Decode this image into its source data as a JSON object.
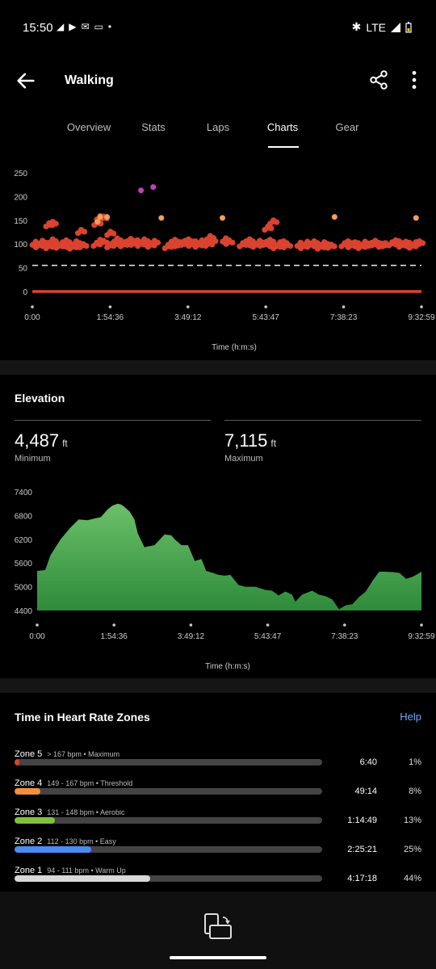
{
  "status_bar": {
    "time": "15:50",
    "network": "LTE",
    "icons": [
      "telegram-icon",
      "youtube-icon",
      "outlook-icon",
      "screen-icon",
      "dot-icon"
    ]
  },
  "header": {
    "title": "Walking"
  },
  "tabs": [
    {
      "label": "Overview",
      "active": false
    },
    {
      "label": "Stats",
      "active": false
    },
    {
      "label": "Laps",
      "active": false
    },
    {
      "label": "Charts",
      "active": true
    },
    {
      "label": "Gear",
      "active": false
    }
  ],
  "hr_chart": {
    "y_ticks": [
      "250",
      "200",
      "150",
      "100",
      "50",
      "0"
    ],
    "x_ticks": [
      "0:00",
      "1:54:36",
      "3:49:12",
      "5:43:47",
      "7:38:23",
      "9:32:59"
    ],
    "x_label": "Time (h:m:s)",
    "colors": {
      "main": "#d9432f",
      "high": "#f0a05a",
      "max": "#c23fc0",
      "baseline": "#d9432f"
    }
  },
  "chart_data": [
    {
      "type": "scatter",
      "title": "",
      "xlabel": "Time (h:m:s)",
      "ylabel": "",
      "xlim": [
        "0:00",
        "9:32:59"
      ],
      "ylim": [
        0,
        250
      ],
      "reference_line": 55,
      "series": [
        {
          "name": "",
          "points": [
            [
              "0:05",
              103
            ],
            [
              "0:10",
              98
            ],
            [
              "0:15",
              105
            ],
            [
              "0:20",
              101
            ],
            [
              "0:25",
              96
            ],
            [
              "0:30",
              108
            ],
            [
              "0:35",
              100
            ],
            [
              "0:40",
              97
            ],
            [
              "0:45",
              102
            ],
            [
              "0:50",
              106
            ],
            [
              "0:55",
              99
            ],
            [
              "1:00",
              95
            ],
            [
              "1:05",
              104
            ],
            [
              "1:10",
              100
            ],
            [
              "1:15",
              98
            ],
            [
              "1:35",
              101
            ],
            [
              "1:40",
              107
            ],
            [
              "1:45",
              105
            ],
            [
              "1:55",
              98
            ],
            [
              "2:00",
              102
            ],
            [
              "2:05",
              110
            ],
            [
              "2:10",
              106
            ],
            [
              "2:15",
              100
            ],
            [
              "2:20",
              104
            ],
            [
              "2:25",
              109
            ],
            [
              "2:30",
              103
            ],
            [
              "2:35",
              106
            ],
            [
              "2:40",
              101
            ],
            [
              "2:45",
              108
            ],
            [
              "2:50",
              104
            ],
            [
              "2:55",
              99
            ],
            [
              "3:00",
              105
            ],
            [
              "3:20",
              96
            ],
            [
              "3:25",
              103
            ],
            [
              "3:30",
              107
            ],
            [
              "3:35",
              100
            ],
            [
              "3:40",
              102
            ],
            [
              "3:45",
              105
            ],
            [
              "3:50",
              108
            ],
            [
              "3:55",
              101
            ],
            [
              "4:00",
              104
            ],
            [
              "4:05",
              99
            ],
            [
              "4:10",
              106
            ],
            [
              "4:15",
              103
            ],
            [
              "4:20",
              101
            ],
            [
              "4:45",
              110
            ],
            [
              "4:50",
              105
            ],
            [
              "5:10",
              100
            ],
            [
              "5:15",
              104
            ],
            [
              "5:20",
              108
            ],
            [
              "5:25",
              102
            ],
            [
              "5:30",
              99
            ],
            [
              "5:35",
              105
            ],
            [
              "5:40",
              101
            ],
            [
              "5:45",
              103
            ],
            [
              "5:50",
              107
            ],
            [
              "5:55",
              100
            ],
            [
              "6:00",
              96
            ],
            [
              "6:05",
              102
            ],
            [
              "6:10",
              104
            ],
            [
              "6:15",
              98
            ],
            [
              "6:35",
              101
            ],
            [
              "6:40",
              96
            ],
            [
              "6:45",
              103
            ],
            [
              "6:50",
              99
            ],
            [
              "6:55",
              104
            ],
            [
              "7:00",
              100
            ],
            [
              "7:05",
              95
            ],
            [
              "7:10",
              102
            ],
            [
              "7:15",
              98
            ],
            [
              "7:20",
              97
            ],
            [
              "7:40",
              100
            ],
            [
              "7:45",
              104
            ],
            [
              "7:50",
              98
            ],
            [
              "7:55",
              102
            ],
            [
              "8:00",
              100
            ],
            [
              "8:05",
              96
            ],
            [
              "8:10",
              103
            ],
            [
              "8:15",
              99
            ],
            [
              "8:20",
              101
            ],
            [
              "8:25",
              105
            ],
            [
              "8:35",
              99
            ],
            [
              "8:40",
              100
            ],
            [
              "8:50",
              102
            ],
            [
              "8:55",
              106
            ],
            [
              "9:00",
              104
            ],
            [
              "9:05",
              99
            ],
            [
              "9:10",
              103
            ],
            [
              "9:15",
              101
            ],
            [
              "9:20",
              97
            ],
            [
              "9:25",
              102
            ],
            [
              "9:30",
              104
            ],
            [
              "0:30",
              145
            ],
            [
              "0:25",
              142
            ],
            [
              "1:12",
              128
            ],
            [
              "1:36",
              145
            ],
            [
              "1:40",
              157
            ],
            [
              "1:45",
              156
            ],
            [
              "1:55",
              124
            ],
            [
              "4:25",
              108
            ],
            [
              "4:22",
              115
            ],
            [
              "5:55",
              148
            ],
            [
              "5:47",
              135
            ]
          ]
        },
        {
          "name": "",
          "points": [
            [
              "1:40",
              157
            ],
            [
              "1:50",
              157
            ],
            [
              "3:10",
              155
            ],
            [
              "4:40",
              155
            ],
            [
              "7:25",
              157
            ],
            [
              "9:25",
              155
            ],
            [
              "1:36",
              147
            ]
          ]
        },
        {
          "name": "",
          "points": [
            [
              "2:40",
              213
            ],
            [
              "2:58",
              220
            ]
          ]
        },
        {
          "name": "",
          "points": [
            [
              "0:00",
              0
            ],
            [
              "9:32:59",
              0
            ]
          ]
        }
      ]
    },
    {
      "type": "area",
      "title": "Elevation",
      "xlabel": "Time (h:m:s)",
      "ylabel": "",
      "xlim": [
        "0:00",
        "9:32:59"
      ],
      "ylim": [
        4400,
        7400
      ],
      "color": "#4caf50",
      "x_minutes": [
        0,
        12,
        20,
        35,
        50,
        62,
        75,
        85,
        95,
        105,
        112,
        120,
        125,
        130,
        138,
        145,
        150,
        160,
        175,
        190,
        200,
        205,
        215,
        225,
        235,
        245,
        252,
        262,
        270,
        280,
        288,
        300,
        310,
        325,
        340,
        350,
        360,
        370,
        380,
        385,
        395,
        410,
        420,
        430,
        440,
        450,
        460,
        470,
        480,
        490,
        500,
        510,
        520,
        530,
        540,
        550,
        560,
        570,
        573
      ],
      "values": [
        5400,
        5420,
        5800,
        6200,
        6500,
        6700,
        6680,
        6720,
        6760,
        6950,
        7050,
        7100,
        7080,
        7020,
        6900,
        6700,
        6350,
        6000,
        6050,
        6320,
        6300,
        6200,
        6050,
        6050,
        5650,
        5700,
        5400,
        5350,
        5300,
        5280,
        5300,
        5050,
        5000,
        5000,
        4920,
        4900,
        4780,
        4880,
        4800,
        4620,
        4800,
        4900,
        4800,
        4760,
        4680,
        4430,
        4530,
        4560,
        4740,
        4880,
        5150,
        5380,
        5380,
        5370,
        5350,
        5200,
        5250,
        5350,
        5380
      ]
    }
  ],
  "elevation": {
    "title": "Elevation",
    "min_value": "4,487",
    "min_unit": "ft",
    "min_label": "Minimum",
    "max_value": "7,115",
    "max_unit": "ft",
    "max_label": "Maximum",
    "y_ticks": [
      "7400",
      "6800",
      "6200",
      "5600",
      "5000",
      "4400"
    ],
    "x_ticks": [
      "0:00",
      "1:54:36",
      "3:49:12",
      "5:43:47",
      "7:38:23",
      "9:32:59"
    ],
    "x_label": "Time (h:m:s)"
  },
  "zones": {
    "title": "Time in Heart Rate Zones",
    "help": "Help",
    "items": [
      {
        "name": "Zone 5",
        "desc": "> 167 bpm • Maximum",
        "time": "6:40",
        "pct": "1%",
        "fraction": 0.012,
        "color": "#d9432f"
      },
      {
        "name": "Zone 4",
        "desc": "149 - 167 bpm • Threshold",
        "time": "49:14",
        "pct": "8%",
        "fraction": 0.085,
        "color": "#f0913a"
      },
      {
        "name": "Zone 3",
        "desc": "131 - 148 bpm • Aerobic",
        "time": "1:14:49",
        "pct": "13%",
        "fraction": 0.13,
        "color": "#7fc13a"
      },
      {
        "name": "Zone 2",
        "desc": "112 - 130 bpm • Easy",
        "time": "2:25:21",
        "pct": "25%",
        "fraction": 0.25,
        "color": "#4a8cf0"
      },
      {
        "name": "Zone 1",
        "desc": "94 - 111 bpm • Warm Up",
        "time": "4:17:18",
        "pct": "44%",
        "fraction": 0.44,
        "color": "#d8d8d8"
      }
    ]
  }
}
